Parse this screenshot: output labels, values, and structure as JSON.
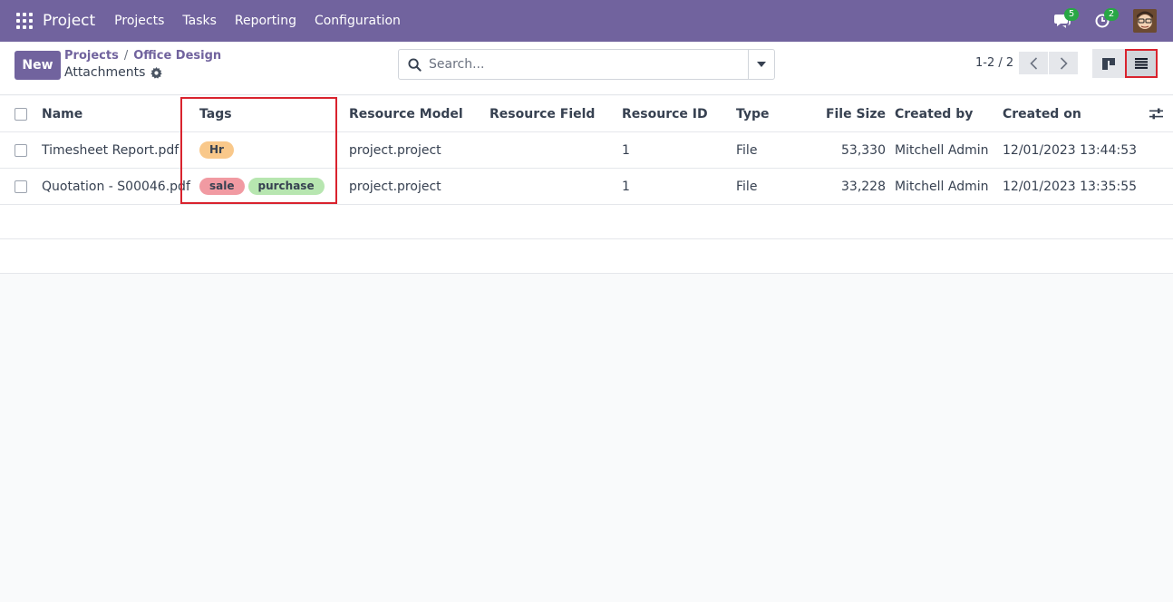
{
  "navbar": {
    "brand": "Project",
    "menu": [
      "Projects",
      "Tasks",
      "Reporting",
      "Configuration"
    ],
    "messages_badge": "5",
    "activities_badge": "2",
    "bg_color": "#71639e"
  },
  "control": {
    "new_label": "New",
    "breadcrumb": [
      "Projects",
      "Office Design"
    ],
    "title": "Attachments",
    "search_placeholder": "Search...",
    "pager": "1-2 / 2"
  },
  "table": {
    "headers": {
      "name": "Name",
      "tags": "Tags",
      "resource_model": "Resource Model",
      "resource_field": "Resource Field",
      "resource_id": "Resource ID",
      "type": "Type",
      "file_size": "File Size",
      "created_by": "Created by",
      "created_on": "Created on"
    },
    "rows": [
      {
        "name": "Timesheet Report.pdf",
        "tags": [
          {
            "label": "Hr",
            "color": "#f9c88a"
          }
        ],
        "resource_model": "project.project",
        "resource_field": "",
        "resource_id": "1",
        "type": "File",
        "file_size": "53,330",
        "created_by": "Mitchell Admin",
        "created_on": "12/01/2023 13:44:53"
      },
      {
        "name": "Quotation - S00046.pdf",
        "tags": [
          {
            "label": "sale",
            "color": "#f19aa2"
          },
          {
            "label": "purchase",
            "color": "#b7e6b0"
          }
        ],
        "resource_model": "project.project",
        "resource_field": "",
        "resource_id": "1",
        "type": "File",
        "file_size": "33,228",
        "created_by": "Mitchell Admin",
        "created_on": "12/01/2023 13:35:55"
      }
    ]
  }
}
